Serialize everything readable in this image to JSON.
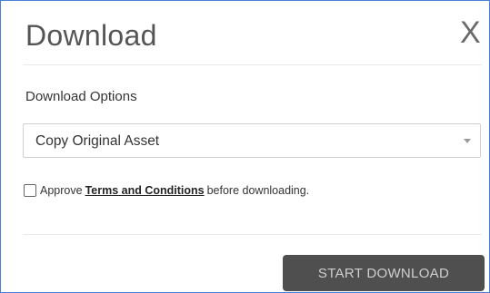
{
  "dialog": {
    "title": "Download",
    "close_label": "X"
  },
  "download_options": {
    "label": "Download Options",
    "selected_value": "Copy Original Asset",
    "caret_icon": "chevron-down-icon"
  },
  "approval": {
    "checked": false,
    "prefix": "Approve",
    "link_text": "Terms and Conditions",
    "suffix": "before downloading."
  },
  "footer": {
    "start_button_label": "START DOWNLOAD"
  },
  "colors": {
    "dialog_border": "#4a7fd6",
    "button_bg": "#4f4f4f",
    "button_text": "#cfcfcf"
  }
}
